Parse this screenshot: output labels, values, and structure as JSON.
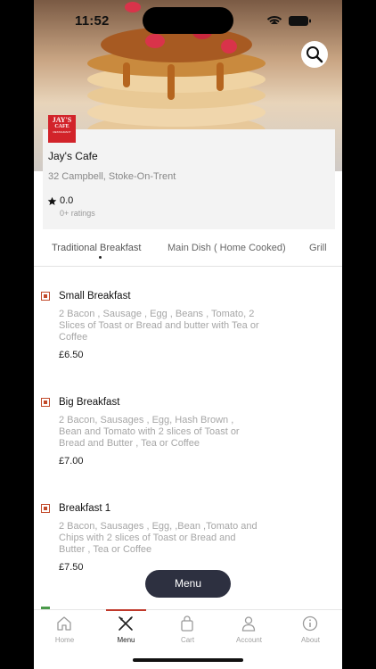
{
  "status_bar": {
    "time": "11:52"
  },
  "restaurant": {
    "logo_text": [
      "JAY'S",
      "CAFE",
      "RESTAURANT"
    ],
    "name": "Jay's Cafe",
    "address": "32 Campbell, Stoke-On-Trent",
    "rating": "0.0",
    "ratings_count": "0+ ratings"
  },
  "tabs": [
    {
      "label": "Traditional Breakfast",
      "active": true
    },
    {
      "label": "Main Dish ( Home Cooked)",
      "active": false
    },
    {
      "label": "Grill",
      "active": false
    }
  ],
  "menu_items": [
    {
      "title": "Small Breakfast",
      "description": "2 Bacon , Sausage , Egg , Beans , Tomato, 2 Slices of Toast or  Bread and butter with Tea or Coffee",
      "price": "£6.50"
    },
    {
      "title": "Big Breakfast",
      "description": "2 Bacon, Sausages , Egg, Hash Brown , Bean and Tomato with 2 slices of Toast or Bread  and Butter , Tea or Coffee",
      "price": "£7.00"
    },
    {
      "title": "Breakfast 1",
      "description": "2 Bacon, Sausages , Egg, ,Bean ,Tomato and Chips  with 2 slices of Toast or Bread and Butter , Tea or Coffee",
      "price": "£7.50"
    }
  ],
  "floating_button": {
    "label": "Menu"
  },
  "bottom_nav": [
    {
      "label": "Home",
      "icon": "home-icon",
      "active": false
    },
    {
      "label": "Menu",
      "icon": "cutlery-icon",
      "active": true
    },
    {
      "label": "Cart",
      "icon": "bag-icon",
      "active": false
    },
    {
      "label": "Account",
      "icon": "person-icon",
      "active": false
    },
    {
      "label": "About",
      "icon": "info-icon",
      "active": false
    }
  ],
  "colors": {
    "accent": "#c0392b",
    "logo_red": "#d2232a",
    "fab_bg": "#2d3040",
    "card_bg": "#f3f3f3"
  }
}
